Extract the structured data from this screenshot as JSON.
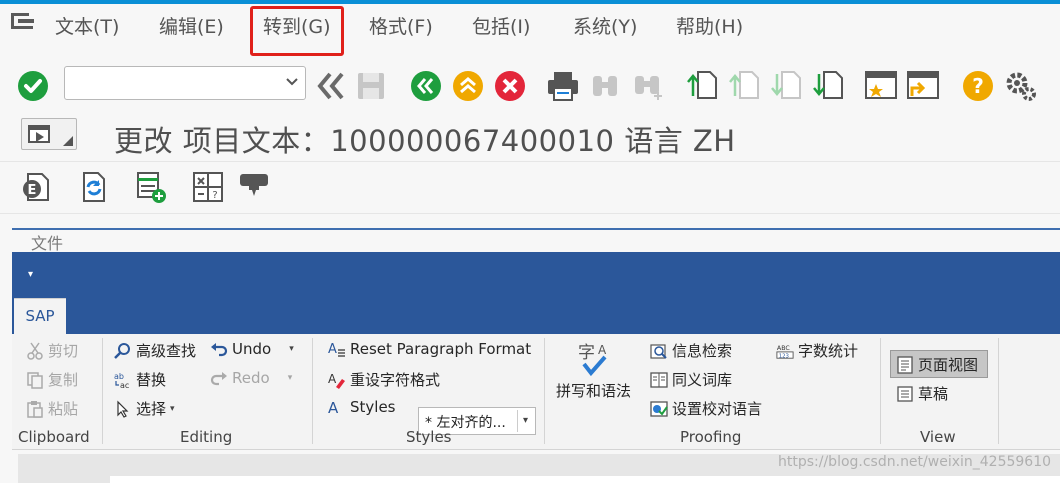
{
  "menu": {
    "items": [
      {
        "label": "文本(T)"
      },
      {
        "label": "编辑(E)"
      },
      {
        "label": "转到(G)"
      },
      {
        "label": "格式(F)"
      },
      {
        "label": "包括(I)"
      },
      {
        "label": "系统(Y)"
      },
      {
        "label": "帮助(H)"
      }
    ]
  },
  "toolbar": {
    "command_value": "",
    "icons": [
      "enter-check-icon",
      "back-arrows-icon",
      "save-icon",
      "back-green-icon",
      "exit-yellow-icon",
      "cancel-red-icon",
      "print-icon",
      "find-icon",
      "find-next-icon",
      "first-page-icon",
      "previous-page-icon",
      "next-page-icon",
      "last-page-icon",
      "create-session-icon",
      "shortcut-icon",
      "help-icon",
      "settings-gear-icon"
    ]
  },
  "title": {
    "text": "更改 项目文本：100000067400010 语言 ZH"
  },
  "word": {
    "file_label": "文件",
    "tab": "SAP",
    "clipboard": {
      "cut": "剪切",
      "copy": "复制",
      "paste": "粘贴",
      "group": "Clipboard"
    },
    "editing": {
      "find": "高级查找",
      "replace": "替换",
      "select": "选择",
      "undo": "Undo",
      "redo": "Redo",
      "group": "Editing"
    },
    "styles": {
      "reset": "Reset Paragraph Format",
      "reset_char": "重设字符格式",
      "styles": "Styles",
      "selected": "* 左对齐的...",
      "group": "Styles"
    },
    "proofing": {
      "spelling": "拼写和语法",
      "research": "信息检索",
      "thesaurus": "同义词库",
      "language": "设置校对语言",
      "wordcount": "字数统计",
      "group": "Proofing"
    },
    "view": {
      "page": "页面视图",
      "draft": "草稿",
      "group": "View"
    }
  },
  "watermark": "https://blog.csdn.net/weixin_42559610",
  "colors": {
    "accent_blue": "#2b579a",
    "sap_green": "#1e9e3e",
    "sap_yellow": "#f0a800",
    "sap_red": "#e3263a",
    "highlight_red": "#e0201a"
  }
}
